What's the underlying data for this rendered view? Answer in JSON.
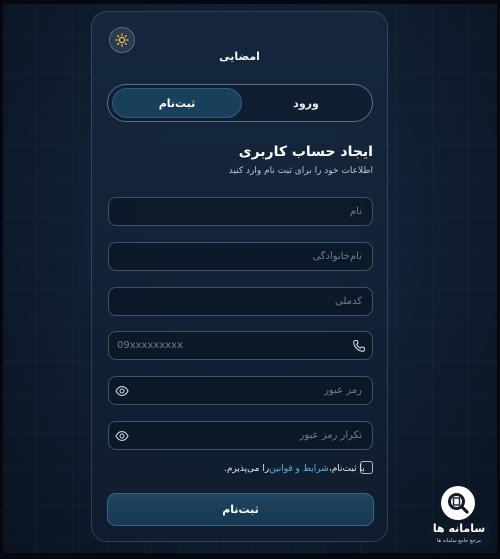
{
  "brand": {
    "title": "امضایی"
  },
  "theme_toggle": {
    "icon": "sun-icon"
  },
  "tabs": [
    {
      "label": "ثبت‌نام",
      "active": true
    },
    {
      "label": "ورود",
      "active": false
    }
  ],
  "form": {
    "heading": "ایجاد حساب کاربری",
    "subheading": "اطلاعات خود را برای ثبت نام وارد کنید",
    "first_name": {
      "placeholder": "نام",
      "value": ""
    },
    "last_name": {
      "placeholder": "نام‌خانوادگی",
      "value": ""
    },
    "national_code": {
      "placeholder": "کدملی",
      "value": ""
    },
    "phone": {
      "placeholder": "09xxxxxxxxx",
      "value": "",
      "icon": "phone-icon"
    },
    "password": {
      "placeholder": "رمز عبور",
      "value": "",
      "icon": "eye-icon"
    },
    "password_confirm": {
      "placeholder": "تکرار رمز عبور",
      "value": "",
      "icon": "eye-icon"
    },
    "terms": {
      "prefix": "با ثبت‌نام، ",
      "link": "شرایط و قوانین",
      "suffix": " را می‌پذیرم.",
      "checked": false
    },
    "submit_label": "ثبت‌نام"
  },
  "watermark": {
    "title": "سامانه ها",
    "subtitle": "مرجع جامع سامانه ها"
  },
  "colors": {
    "background": "#0b1523",
    "accent": "#19405a",
    "link": "#5fb2dd"
  }
}
